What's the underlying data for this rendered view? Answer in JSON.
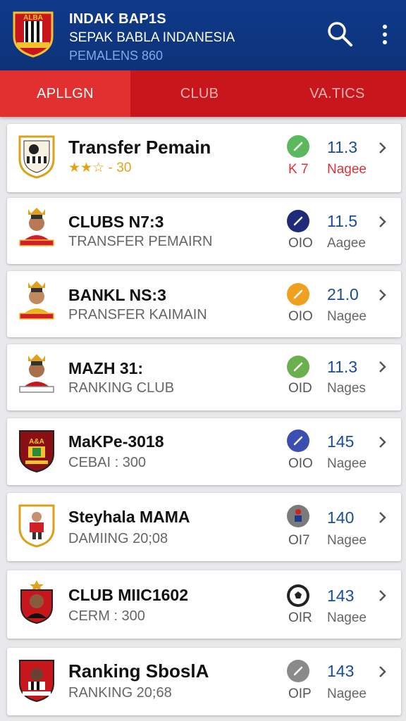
{
  "header": {
    "title": "INDAK BAP1S",
    "subtitle": "SEPAK BABLA INDANESIA",
    "subtitle2": "PEMALENS 860",
    "logo_text": "ALBA",
    "colors": {
      "bg": "#0f3a8a",
      "accent": "#c8161d"
    }
  },
  "tabs": [
    {
      "label": "APLLGN",
      "active": true
    },
    {
      "label": "CLUB",
      "active": false
    },
    {
      "label": "VA.TICS",
      "active": false
    }
  ],
  "items": [
    {
      "name": "Transfer Pemain",
      "sub": "- 30",
      "stars": "★★☆",
      "icon": "check-icon",
      "icon_color": "#5cb85c",
      "code": "K 7",
      "rating": "11.3",
      "unit": "Nagee",
      "badge": "crest-badge"
    },
    {
      "name": "CLUBS N7:3",
      "sub": "TRANSFER PEMAIRN",
      "icon": "check-icon",
      "icon_color": "#1f2a7a",
      "code": "OIO",
      "rating": "11.5",
      "unit": "Aagee",
      "badge": "player-badge"
    },
    {
      "name": "BANKL NS:3",
      "sub": "PRANSFER KAIMAIN",
      "icon": "check-icon",
      "icon_color": "#f0a020",
      "code": "OIO",
      "rating": "21.0",
      "unit": "Nagee",
      "badge": "player-badge"
    },
    {
      "name": "MAZH 31:",
      "sub": "RANKING CLUB",
      "icon": "check-icon",
      "icon_color": "#6ab04c",
      "code": "OID",
      "rating": "11.3",
      "unit": "Nages",
      "badge": "player-badge"
    },
    {
      "name": "MaKPe-3018",
      "sub": "CEBAI : 300",
      "icon": "check-icon",
      "icon_color": "#3a4fb0",
      "code": "OIO",
      "rating": "145",
      "unit": "Nagee",
      "badge": "club-badge"
    },
    {
      "name": "Steyhala MAMA",
      "sub": "DAMIING 20;08",
      "icon": "player-icon",
      "icon_color": "#7b7b7b",
      "code": "OI7",
      "rating": "140",
      "unit": "Nagee",
      "badge": "player-badge"
    },
    {
      "name": "CLUB MIIC1602",
      "sub": "CERM : 300",
      "icon": "ball-icon",
      "icon_color": "#222222",
      "code": "OIR",
      "rating": "143",
      "unit": "Nagee",
      "badge": "player-badge"
    },
    {
      "name": "Ranking SboslA",
      "sub": "RANKING 20;68",
      "icon": "check-icon",
      "icon_color": "#8a8a8a",
      "code": "OIP",
      "rating": "143",
      "unit": "Nagee",
      "badge": "player-badge"
    }
  ]
}
